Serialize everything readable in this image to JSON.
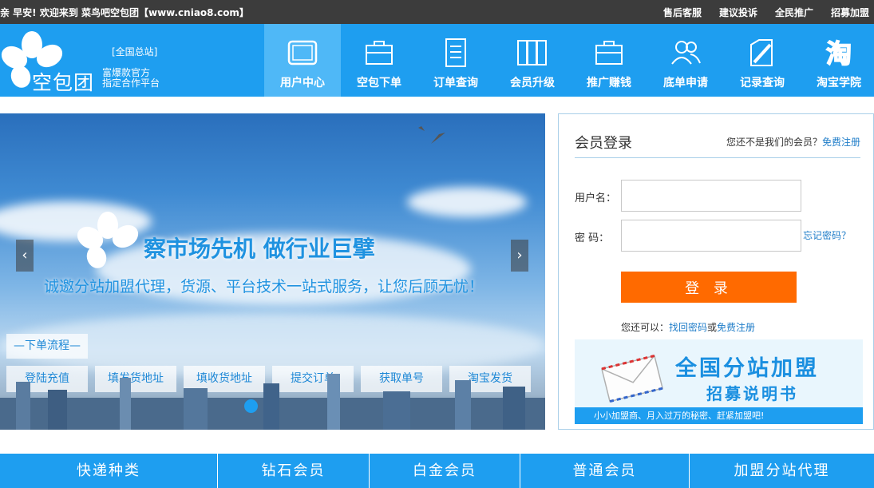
{
  "topbar": {
    "welcome": "亲 早安! 欢迎来到 菜鸟吧空包团【www.cniao8.com】",
    "links": [
      "售后客服",
      "建议投诉",
      "全民推广",
      "招募加盟"
    ]
  },
  "logo": {
    "brand": "空包团",
    "station": "[全国总站]",
    "slogan_line1": "富爆款官方",
    "slogan_line2": "指定合作平台"
  },
  "nav": {
    "items": [
      {
        "label": "用户中心",
        "icon": "tablet-icon"
      },
      {
        "label": "空包下单",
        "icon": "briefcase-icon"
      },
      {
        "label": "订单查询",
        "icon": "document-list-icon"
      },
      {
        "label": "会员升级",
        "icon": "books-icon"
      },
      {
        "label": "推广赚钱",
        "icon": "briefcase-icon"
      },
      {
        "label": "底单申请",
        "icon": "users-icon"
      },
      {
        "label": "记录查询",
        "icon": "edit-document-icon"
      },
      {
        "label": "淘宝学院",
        "icon": "taobao-icon"
      }
    ]
  },
  "banner": {
    "headline": "察市场先机 做行业巨擘",
    "subline": "诚邀分站加盟代理，货源、平台技术一站式服务，让您后顾无忧！",
    "prev": "‹",
    "next": "›",
    "flow_title": "—下单流程—",
    "steps": [
      "登陆充值",
      "填发货地址",
      "填收货地址",
      "提交订单",
      "获取单号",
      "淘宝发货"
    ]
  },
  "login": {
    "title": "会员登录",
    "not_member": "您还不是我们的会员？",
    "register": "免费注册",
    "username_label": "用户名：",
    "password_label": "密 码：",
    "forgot": "忘记密码？",
    "submit": "登 录",
    "also_prefix": "您还可以：",
    "recover": "找回密码",
    "or": "或",
    "register2": "免费注册"
  },
  "promo": {
    "line1": "全国分站加盟",
    "line2": "招募说明书",
    "strip": "小小加盟商、月入过万的秘密、赶紧加盟吧!"
  },
  "bottomnav": {
    "items": [
      "快递种类",
      "钻石会员",
      "白金会员",
      "普通会员",
      "加盟分站代理"
    ]
  },
  "colors": {
    "primary": "#1e9ef0",
    "topbar": "#3c3c3c",
    "login_button": "#ff6a00",
    "link": "#1e7cc8"
  }
}
